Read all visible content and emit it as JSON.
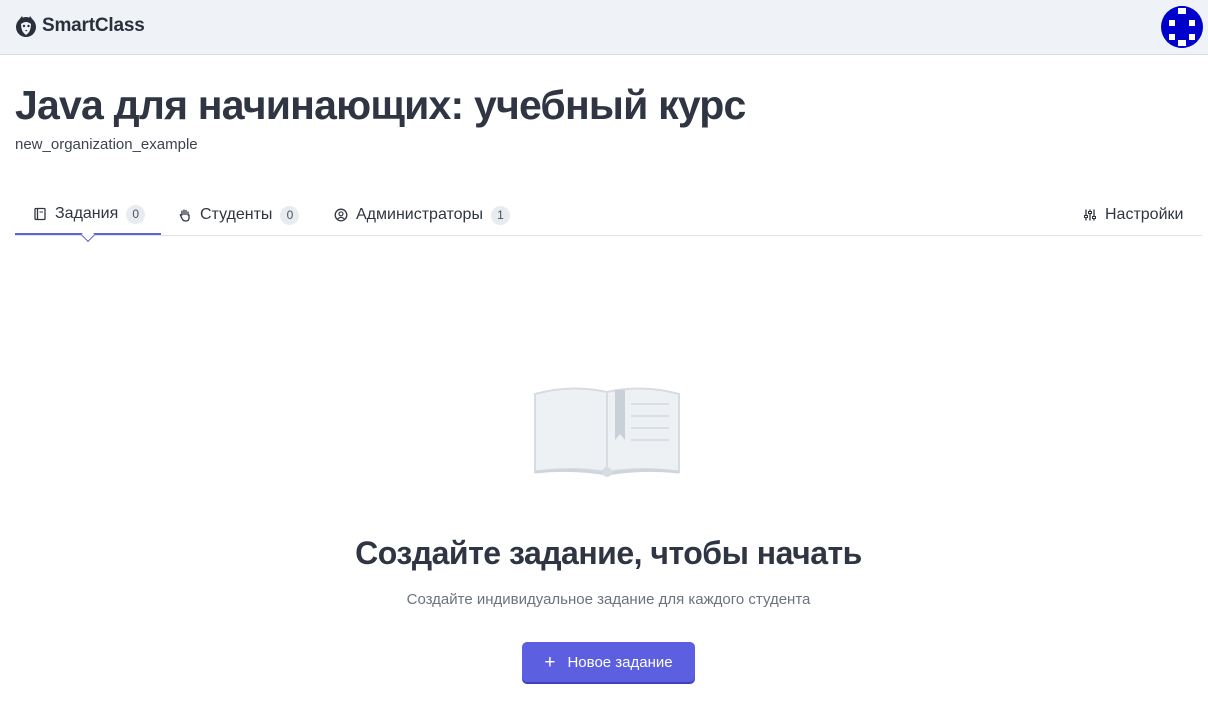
{
  "header": {
    "brand_name": "SmartClass",
    "brand_icon": "fox-logo-icon",
    "avatar_icon": "user-avatar-icon"
  },
  "course": {
    "title": "Java для начинающих: учебный курс",
    "organization": "new_organization_example"
  },
  "tabs": [
    {
      "label": "Задания",
      "count": "0",
      "icon": "book-icon",
      "active": true
    },
    {
      "label": "Студенты",
      "count": "0",
      "icon": "hand-icon",
      "active": false
    },
    {
      "label": "Администраторы",
      "count": "1",
      "icon": "user-circle-icon",
      "active": false
    }
  ],
  "settings": {
    "label": "Настройки",
    "icon": "sliders-icon"
  },
  "empty_state": {
    "illustration": "open-book-illustration",
    "title": "Создайте задание, чтобы начать",
    "subtitle": "Создайте индивидуальное задание для каждого студента",
    "button_label": "Новое задание",
    "button_icon": "plus-icon"
  },
  "colors": {
    "accent": "#5b5fe0",
    "topbar_bg": "#eff2f6",
    "avatar": "#0000cc"
  }
}
